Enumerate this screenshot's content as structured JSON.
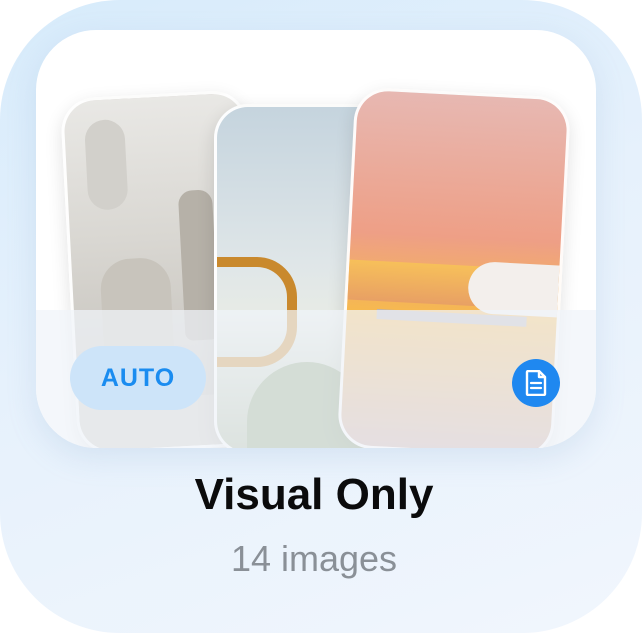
{
  "card": {
    "badge_label": "AUTO",
    "title": "Visual Only",
    "subtitle": "14 images"
  },
  "icons": {
    "document": "document-icon"
  },
  "colors": {
    "accent": "#1f88f0",
    "badge_bg": "#cde4f9",
    "badge_text": "#1a8cf0",
    "title": "#0b0b0c",
    "subtitle": "#8a9097"
  }
}
